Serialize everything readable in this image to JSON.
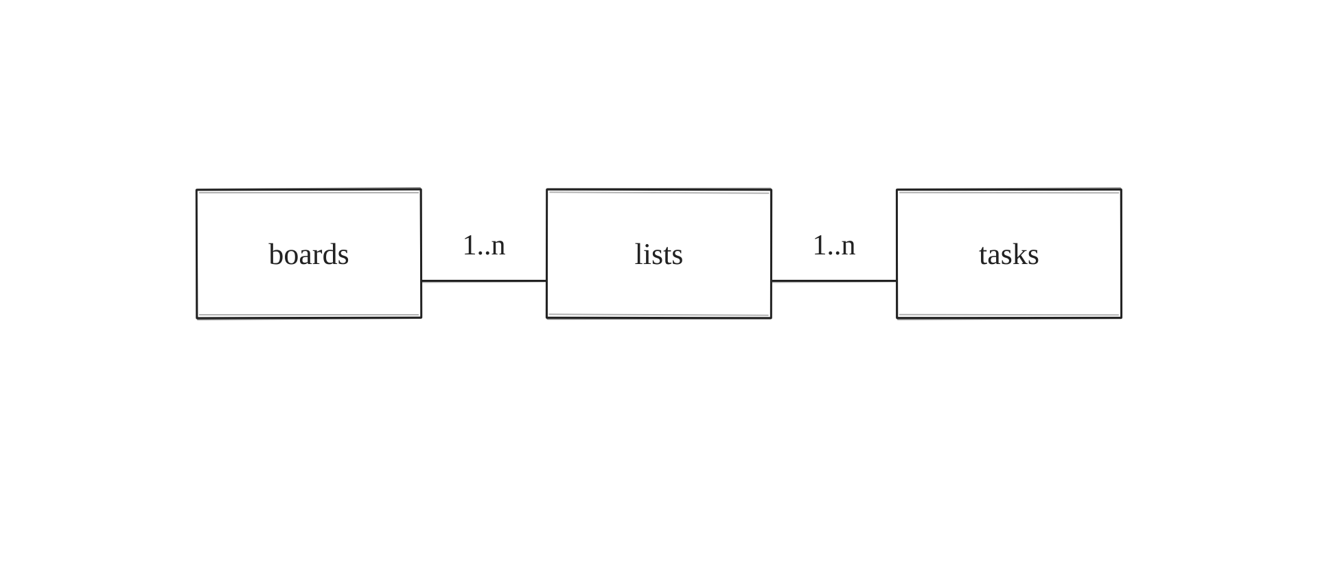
{
  "entities": [
    {
      "key": "boards",
      "label": "boards"
    },
    {
      "key": "lists",
      "label": "lists"
    },
    {
      "key": "tasks",
      "label": "tasks"
    }
  ],
  "relations": [
    {
      "from": "boards",
      "to": "lists",
      "label": "1..n"
    },
    {
      "from": "lists",
      "to": "tasks",
      "label": "1..n"
    }
  ]
}
